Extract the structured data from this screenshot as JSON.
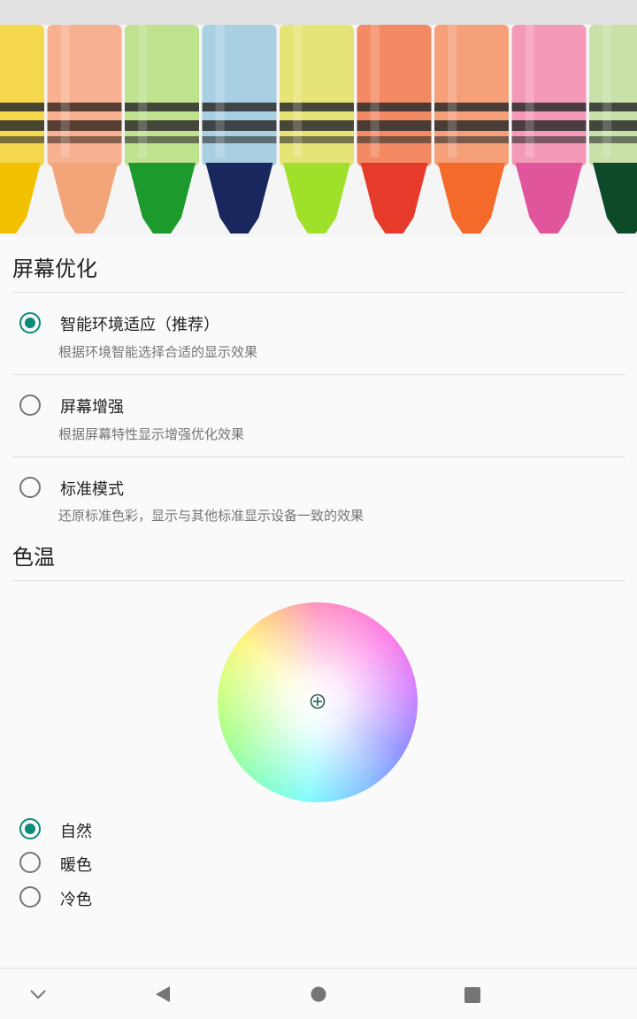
{
  "hero": {
    "crayons": [
      {
        "body": "#f6d84f",
        "tip": "#f2c200",
        "band": "#2b2b2b"
      },
      {
        "body": "#f7b190",
        "tip": "#f3a57a",
        "band": "#3a2a22"
      },
      {
        "body": "#bfe28e",
        "tip": "#1c9a2e",
        "band": "#2b2b2b"
      },
      {
        "body": "#a9cfe3",
        "tip": "#18285e",
        "band": "#2b2b2b"
      },
      {
        "body": "#e6e477",
        "tip": "#9fe02a",
        "band": "#2b2b2b"
      },
      {
        "body": "#f38a63",
        "tip": "#e63b2a",
        "band": "#2b2b2b"
      },
      {
        "body": "#f6a07a",
        "tip": "#f36a2a",
        "band": "#2b2b2b"
      },
      {
        "body": "#f49ab8",
        "tip": "#e0559c",
        "band": "#2b2b2b"
      },
      {
        "body": "#c9e0a8",
        "tip": "#0d4a2a",
        "band": "#2b2b2b"
      }
    ]
  },
  "screen_optimization": {
    "title": "屏幕优化",
    "options": [
      {
        "title": "智能环境适应（推荐）",
        "desc": "根据环境智能选择合适的显示效果",
        "checked": true
      },
      {
        "title": "屏幕增强",
        "desc": "根据屏幕特性显示增强优化效果",
        "checked": false
      },
      {
        "title": "标准模式",
        "desc": "还原标准色彩，显示与其他标准显示设备一致的效果",
        "checked": false
      }
    ]
  },
  "color_temperature": {
    "title": "色温",
    "options": [
      {
        "label": "自然",
        "checked": true
      },
      {
        "label": "暖色",
        "checked": false
      },
      {
        "label": "冷色",
        "checked": false
      }
    ]
  },
  "colors": {
    "accent": "#0a8a78",
    "radio_unchecked": "#757575"
  },
  "nav": {
    "icons": [
      "chevron-down-icon",
      "back-icon",
      "home-icon",
      "recents-icon"
    ]
  }
}
